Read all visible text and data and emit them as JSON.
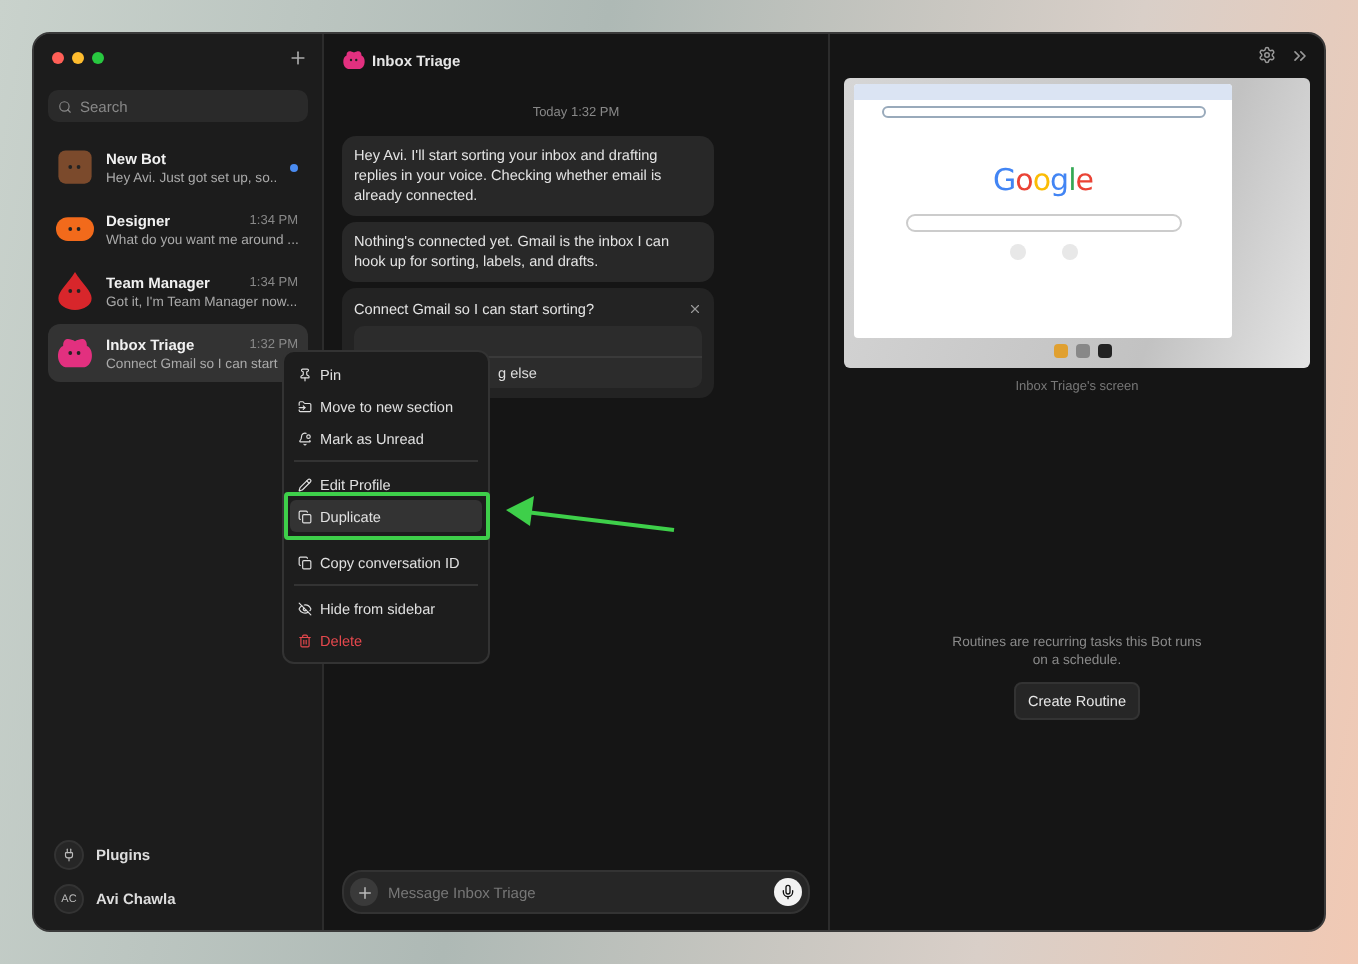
{
  "sidebar": {
    "search": {
      "placeholder": "Search"
    },
    "items": [
      {
        "name": "New Bot",
        "preview": "Hey Avi. Just got set up, so...",
        "unread": true,
        "selected": false,
        "color": "#7b4a2c",
        "kind": "square"
      },
      {
        "name": "Designer",
        "preview": "What do you want me around ...",
        "time": "1:34 PM",
        "unread": false,
        "selected": false,
        "color": "#f26a1b",
        "kind": "pill"
      },
      {
        "name": "Team Manager",
        "preview": "Got it, I'm Team Manager now....",
        "time": "1:34 PM",
        "unread": false,
        "selected": false,
        "color": "#d8262b",
        "kind": "drop"
      },
      {
        "name": "Inbox Triage",
        "preview": "Connect Gmail so I can start",
        "time": "1:32 PM",
        "unread": false,
        "selected": true,
        "color": "#e2307f",
        "kind": "blob"
      }
    ],
    "footer": [
      {
        "label": "Plugins",
        "kind": "plug"
      },
      {
        "label": "Avi Chawla",
        "kind": "avatar",
        "initials": "AC"
      }
    ]
  },
  "chat": {
    "title": "Inbox Triage",
    "color": "#e2307f",
    "timestamp": "Today 1:32 PM",
    "messages": [
      "Hey Avi. I'll start sorting your inbox and drafting replies in your voice. Checking whether email is already connected.",
      "Nothing's connected yet. Gmail is the inbox I can hook up for sorting, labels, and drafts."
    ],
    "prompt": {
      "question": "Connect Gmail so I can start sorting?",
      "options": [
        "g else"
      ]
    },
    "composer": {
      "placeholder": "Message Inbox Triage"
    }
  },
  "context_menu": {
    "groups": [
      [
        {
          "label": "Pin",
          "kind": "pin",
          "selected": false,
          "danger": false
        },
        {
          "label": "Move to new section",
          "kind": "folder",
          "selected": false,
          "danger": false
        },
        {
          "label": "Mark as Unread",
          "kind": "bell",
          "selected": false,
          "danger": false
        }
      ],
      [
        {
          "label": "Edit Profile",
          "kind": "pencil",
          "selected": false,
          "danger": false
        },
        {
          "label": "Duplicate",
          "kind": "copy",
          "selected": true,
          "danger": false
        }
      ],
      [
        {
          "label": "Copy conversation ID",
          "kind": "copy",
          "selected": false,
          "danger": false
        }
      ],
      [
        {
          "label": "Hide from sidebar",
          "kind": "eyeoff",
          "selected": false,
          "danger": false
        },
        {
          "label": "Delete",
          "kind": "trash",
          "selected": false,
          "danger": true
        }
      ]
    ]
  },
  "right_panel": {
    "screen": {
      "logo": "Google",
      "caption": "Inbox Triage's screen"
    },
    "routines": {
      "text": "Routines are recurring tasks this Bot runs on a schedule.",
      "button": "Create Routine"
    }
  }
}
